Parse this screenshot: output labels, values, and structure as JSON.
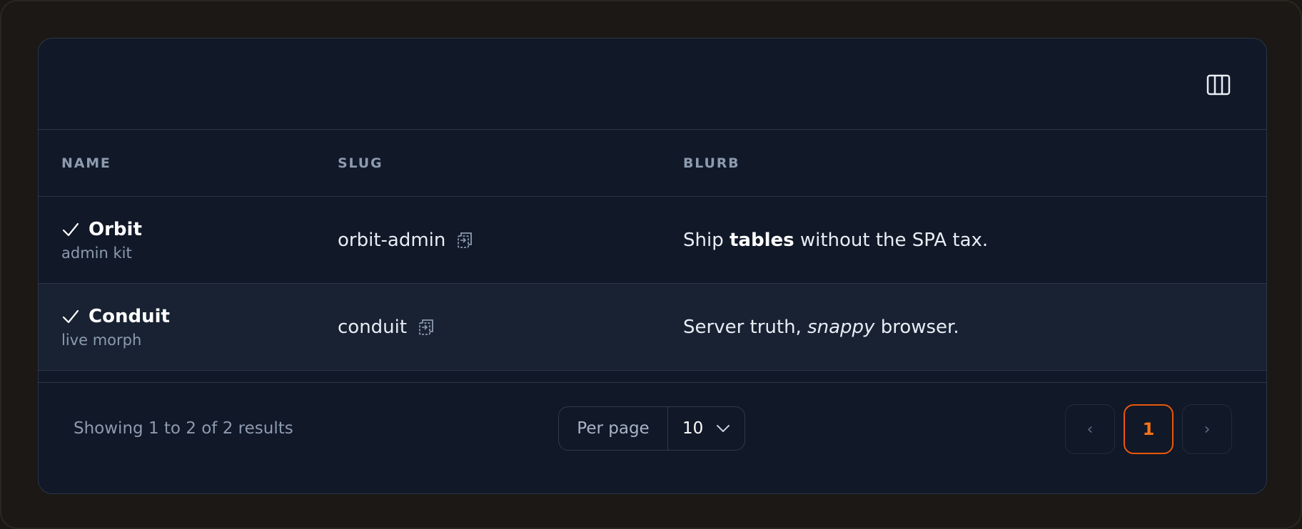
{
  "toolbar": {
    "columns_icon": "columns-icon"
  },
  "table": {
    "headers": [
      "NAME",
      "SLUG",
      "BLURB"
    ],
    "rows": [
      {
        "status_icon": "check-icon",
        "name": "Orbit",
        "subtitle": "admin kit",
        "slug": "orbit-admin",
        "slug_icon": "copy-icon",
        "blurb_before": "Ship ",
        "blurb_emphasis": "tables",
        "blurb_after": " without the SPA tax."
      },
      {
        "status_icon": "check-icon",
        "name": "Conduit",
        "subtitle": "live morph",
        "slug": "conduit",
        "slug_icon": "copy-icon",
        "blurb_before": "Server truth, ",
        "blurb_emphasis": "snappy",
        "blurb_after": " browser."
      }
    ]
  },
  "footer": {
    "summary": "Showing 1 to 2 of 2 results",
    "per_page_label": "Per page",
    "per_page_value": "10",
    "pagination": {
      "prev": "‹",
      "current": "1",
      "next": "›"
    }
  },
  "colors": {
    "background": "#111827",
    "accent": "#f97316",
    "muted_text": "#8c9bb0"
  }
}
